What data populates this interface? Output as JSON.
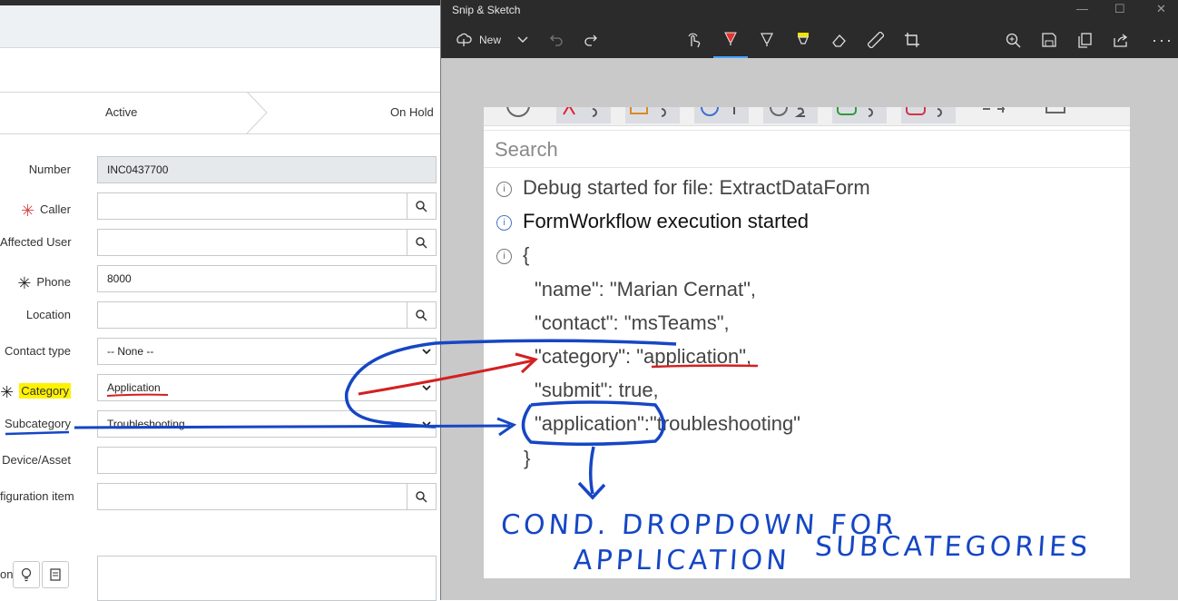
{
  "form": {
    "stages": [
      "Active",
      "On Hold"
    ],
    "fields": {
      "number": {
        "label": "Number",
        "value": "INC0437700"
      },
      "caller": {
        "label": "Caller",
        "value": ""
      },
      "affected_user": {
        "label": "Affected User",
        "value": ""
      },
      "phone": {
        "label": "Phone",
        "value": "8000"
      },
      "location": {
        "label": "Location",
        "value": ""
      },
      "contact_type": {
        "label": "Contact type",
        "value": "-- None --"
      },
      "category": {
        "label": "Category",
        "value": "Application"
      },
      "subcategory": {
        "label": "Subcategory",
        "value": "Troubleshooting"
      },
      "device_asset": {
        "label": "Device/Asset",
        "value": ""
      },
      "config_item": {
        "label": "figuration item",
        "value": ""
      },
      "description": {
        "label": "on",
        "value": ""
      }
    }
  },
  "snip": {
    "title": "Snip & Sketch",
    "new_label": "New",
    "search_placeholder": "Search",
    "log": {
      "line1": "Debug started for file: ExtractDataForm",
      "line2": "FormWorkflow execution started",
      "open_brace": "{",
      "name_line": "\"name\": \"Marian Cernat\",",
      "contact_line": "\"contact\": \"msTeams\",",
      "category_key": "\"category\": \"",
      "category_value": "application",
      "category_end": "\",",
      "submit_line": "\"submit\": true,",
      "application_key": "\"application\":",
      "application_value": "\"troubleshooting\"",
      "close_brace": "}"
    },
    "annotation": {
      "line1": "COND. DROPDOWN FOR",
      "line2": "APPLICATION",
      "line3": "SUBCATEGORIES"
    }
  },
  "colors": {
    "ink_blue": "#1546c4",
    "ink_red": "#d42020",
    "highlight": "#fff200",
    "required_star": "#d14545"
  }
}
